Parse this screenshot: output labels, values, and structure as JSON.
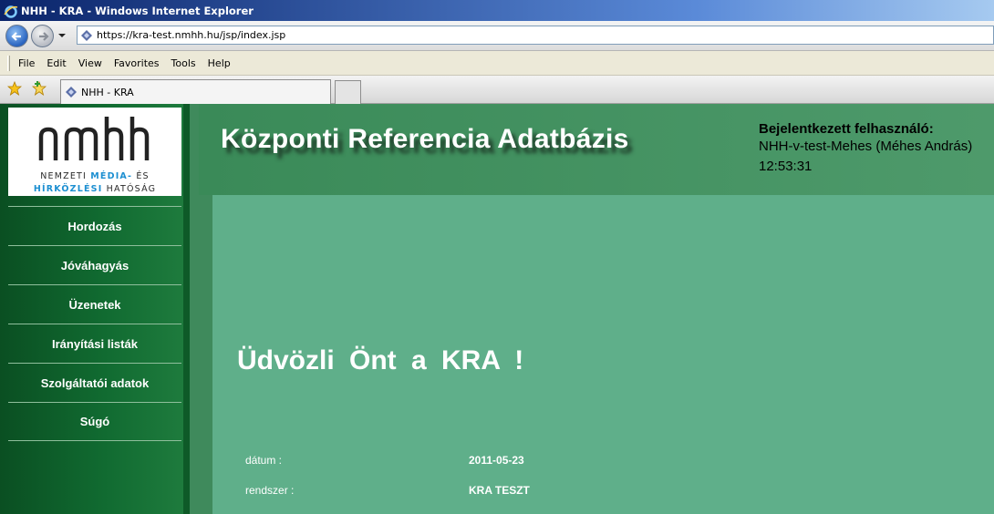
{
  "window": {
    "title": "NHH - KRA - Windows Internet Explorer",
    "url": "https://kra-test.nmhh.hu/jsp/index.jsp"
  },
  "menu": [
    "File",
    "Edit",
    "View",
    "Favorites",
    "Tools",
    "Help"
  ],
  "tab": {
    "label": "NHH - KRA"
  },
  "logo": {
    "mark": "nmhh",
    "line1": "NEMZETI MÉDIA- ÉS",
    "line2": "HÍRKÖZLÉSI HATÓSÁG"
  },
  "sidebar": {
    "items": [
      {
        "label": "Hordozás"
      },
      {
        "label": "Jóváhagyás"
      },
      {
        "label": "Üzenetek"
      },
      {
        "label": "Irányítási listák"
      },
      {
        "label": "Szolgáltatói adatok"
      },
      {
        "label": "Súgó"
      }
    ]
  },
  "header": {
    "title": "Központi Referencia Adatbázis",
    "user_label": "Bejelentkezett felhasználó:",
    "user_name": "NHH-v-test-Mehes (Méhes András)",
    "time": "12:53:31"
  },
  "main": {
    "welcome": "Üdvözli Önt a KRA !",
    "date_label": "dátum :",
    "date_value": "2011-05-23",
    "system_label": "rendszer :",
    "system_value": "KRA TESZT"
  },
  "colors": {
    "sidebar": "#116b31",
    "header": "#4e9a6b",
    "content": "#5faf8a",
    "logo_accent": "#1d8fd1"
  }
}
